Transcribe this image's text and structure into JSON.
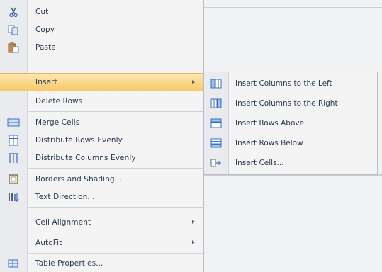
{
  "menu": {
    "items": [
      {
        "label": "Cut",
        "icon": "scissors-icon"
      },
      {
        "label": "Copy",
        "icon": "copy-icon"
      },
      {
        "label": "Paste",
        "icon": "paste-icon"
      },
      {
        "label": "Insert",
        "icon": "",
        "submenu": true,
        "highlighted": true
      },
      {
        "label": "Delete Rows",
        "icon": ""
      },
      {
        "label": "Merge Cells",
        "icon": "merge-cells-icon"
      },
      {
        "label": "Distribute Rows Evenly",
        "icon": "distribute-rows-icon"
      },
      {
        "label": "Distribute Columns Evenly",
        "icon": "distribute-columns-icon"
      },
      {
        "label": "Borders and Shading...",
        "icon": "borders-icon"
      },
      {
        "label": "Text Direction...",
        "icon": "text-direction-icon"
      },
      {
        "label": "Cell Alignment",
        "icon": "",
        "submenu": true
      },
      {
        "label": "AutoFit",
        "icon": "",
        "submenu": true
      },
      {
        "label": "Table Properties...",
        "icon": "table-properties-icon"
      }
    ]
  },
  "submenu": {
    "items": [
      {
        "label": "Insert Columns to the Left",
        "icon": "insert-columns-left-icon"
      },
      {
        "label": "Insert Columns to the Right",
        "icon": "insert-columns-right-icon"
      },
      {
        "label": "Insert Rows Above",
        "icon": "insert-rows-above-icon"
      },
      {
        "label": "Insert Rows Below",
        "icon": "insert-rows-below-icon"
      },
      {
        "label": "Insert Cells...",
        "icon": "insert-cells-icon"
      }
    ]
  },
  "colors": {
    "highlight": "#f8c867",
    "text": "#2b3a55",
    "accent": "#3a6fc4"
  }
}
